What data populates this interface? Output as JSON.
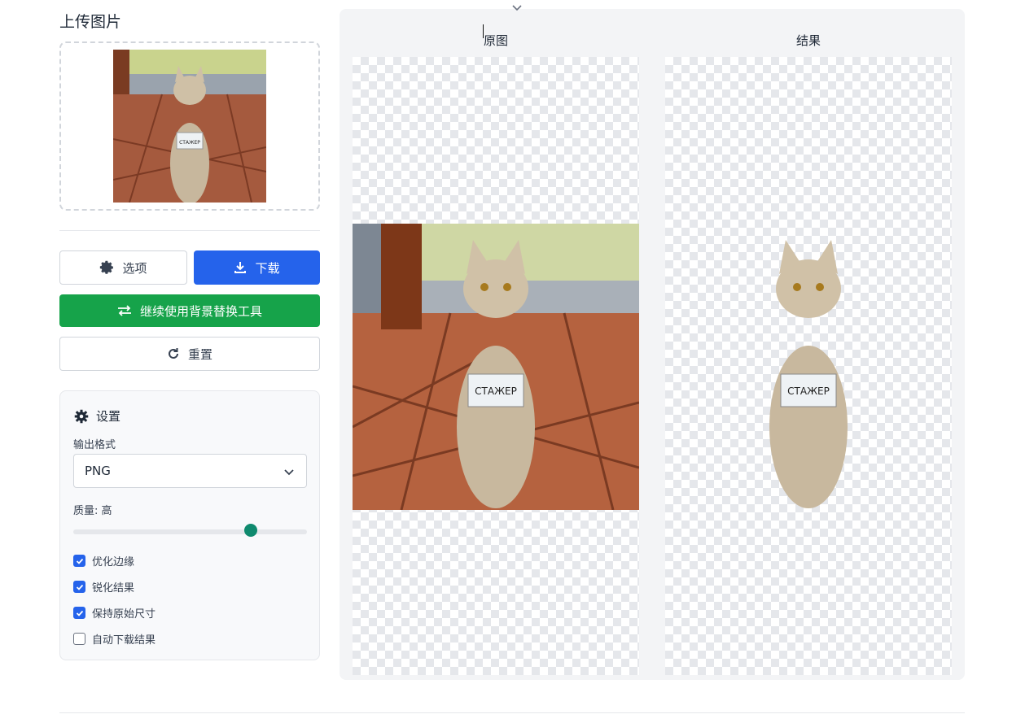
{
  "upload": {
    "title": "上传图片"
  },
  "buttons": {
    "options": "选项",
    "download": "下载",
    "continue": "继续使用背景替换工具",
    "reset": "重置"
  },
  "settings": {
    "title": "设置",
    "format_label": "输出格式",
    "format_value": "PNG",
    "quality_label": "质量: 高",
    "quality_level": 0.76,
    "checkboxes": [
      {
        "label": "优化边缘",
        "checked": true
      },
      {
        "label": "锐化结果",
        "checked": true
      },
      {
        "label": "保持原始尺寸",
        "checked": true
      },
      {
        "label": "自动下载结果",
        "checked": false
      }
    ]
  },
  "compare": {
    "original_title": "原图",
    "result_title": "结果"
  },
  "badge_text": "СТАЖЕР",
  "colors": {
    "primary": "#2563eb",
    "success": "#16a34a",
    "slider": "#0f8a6e"
  }
}
